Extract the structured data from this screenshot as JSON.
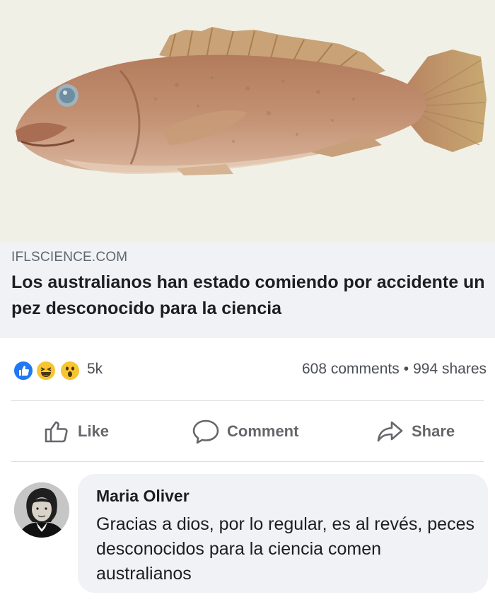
{
  "post": {
    "image": {
      "subject": "fish-photo"
    },
    "link": {
      "domain": "IFLSCIENCE.COM",
      "headline": "Los australianos han estado comiendo por accidente un pez desconocido para la ciencia"
    },
    "reactions": {
      "types": [
        "like",
        "haha",
        "wow"
      ],
      "count": "5k",
      "comments": "608 comments",
      "separator": "•",
      "shares": "994 shares"
    },
    "actions": {
      "like": "Like",
      "comment": "Comment",
      "share": "Share"
    }
  },
  "comment": {
    "author": "Maria Oliver",
    "text": "Gracias a dios, por lo regular, es al revés, peces desconocidos para la ciencia comen australianos"
  },
  "colors": {
    "image_bg": "#f1f0e6",
    "link_bg": "#f0f2f5",
    "like_blue": "#2078f4",
    "emoji_yellow": "#f7c531",
    "muted_text": "#65676b"
  }
}
